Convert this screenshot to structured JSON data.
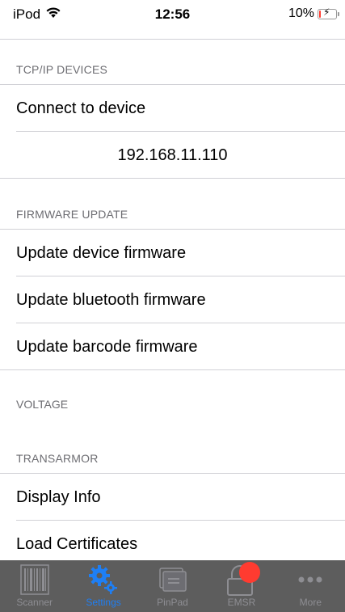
{
  "status_bar": {
    "device": "iPod",
    "time": "12:56",
    "battery": "10%",
    "battery_level": 0.1
  },
  "sections": {
    "tcpip": {
      "header": "TCP/IP DEVICES",
      "items": [
        "Connect to device",
        "192.168.11.110"
      ]
    },
    "firmware": {
      "header": "FIRMWARE UPDATE",
      "items": [
        "Update device firmware",
        "Update bluetooth firmware",
        "Update barcode firmware"
      ]
    },
    "voltage": {
      "header": "VOLTAGE"
    },
    "transarmor": {
      "header": "TRANSARMOR",
      "items": [
        "Display Info",
        "Load Certificates"
      ]
    }
  },
  "tab_bar": {
    "tabs": [
      {
        "label": "Scanner",
        "icon": "barcode-icon"
      },
      {
        "label": "Settings",
        "icon": "gears-icon"
      },
      {
        "label": "PinPad",
        "icon": "pinpad-icon"
      },
      {
        "label": "EMSR",
        "icon": "lock-icon"
      },
      {
        "label": "More",
        "icon": "ellipsis-icon"
      }
    ],
    "active_index": 1,
    "active_color": "#1e7ff5",
    "badge_color": "#ff3b30"
  }
}
